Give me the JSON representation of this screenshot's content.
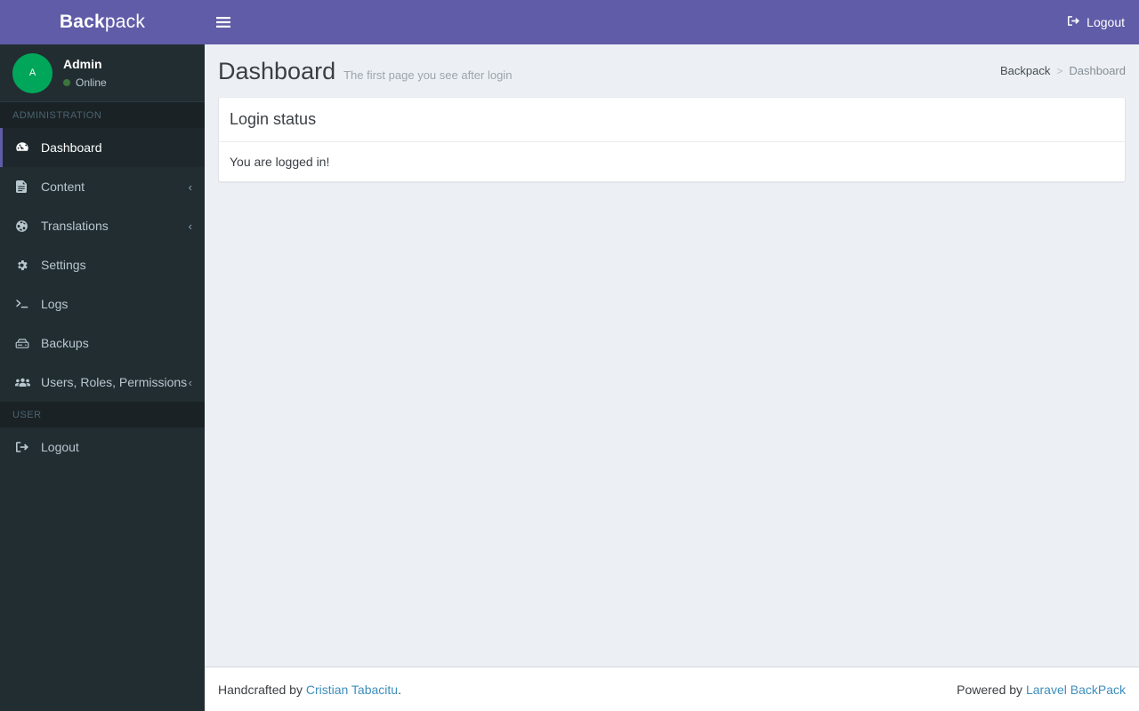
{
  "brand": {
    "bold": "Back",
    "light": "pack",
    "accent_color": "#605ca8"
  },
  "user_panel": {
    "avatar_initial": "A",
    "name": "Admin",
    "status": "Online",
    "status_color": "#3c763d",
    "avatar_color": "#00a65a"
  },
  "sidebar": {
    "sections": [
      {
        "header": "ADMINISTRATION",
        "items": [
          {
            "label": "Dashboard",
            "icon": "tachometer-icon",
            "active": true,
            "chevron": ""
          },
          {
            "label": "Content",
            "icon": "file-text-icon",
            "active": false,
            "chevron": "‹"
          },
          {
            "label": "Translations",
            "icon": "globe-icon",
            "active": false,
            "chevron": "‹"
          },
          {
            "label": "Settings",
            "icon": "gear-icon",
            "active": false,
            "chevron": ""
          },
          {
            "label": "Logs",
            "icon": "terminal-icon",
            "active": false,
            "chevron": ""
          },
          {
            "label": "Backups",
            "icon": "hdd-icon",
            "active": false,
            "chevron": ""
          },
          {
            "label": "Users, Roles, Permissions",
            "icon": "users-icon",
            "active": false,
            "chevron": "‹"
          }
        ]
      },
      {
        "header": "USER",
        "items": [
          {
            "label": "Logout",
            "icon": "sign-out-icon",
            "active": false,
            "chevron": ""
          }
        ]
      }
    ]
  },
  "navbar": {
    "menu_toggle": "hamburger-icon",
    "logout_label": "Logout"
  },
  "content": {
    "title": "Dashboard",
    "subtitle": "The first page you see after login",
    "breadcrumb": {
      "root": "Backpack",
      "separator": ">",
      "current": "Dashboard"
    },
    "card": {
      "title": "Login status",
      "body": "You are logged in!"
    }
  },
  "footer": {
    "left_prefix": "Handcrafted by ",
    "left_link": "Cristian Tabacitu",
    "left_suffix": ".",
    "right_prefix": "Powered by ",
    "right_link": "Laravel BackPack"
  }
}
